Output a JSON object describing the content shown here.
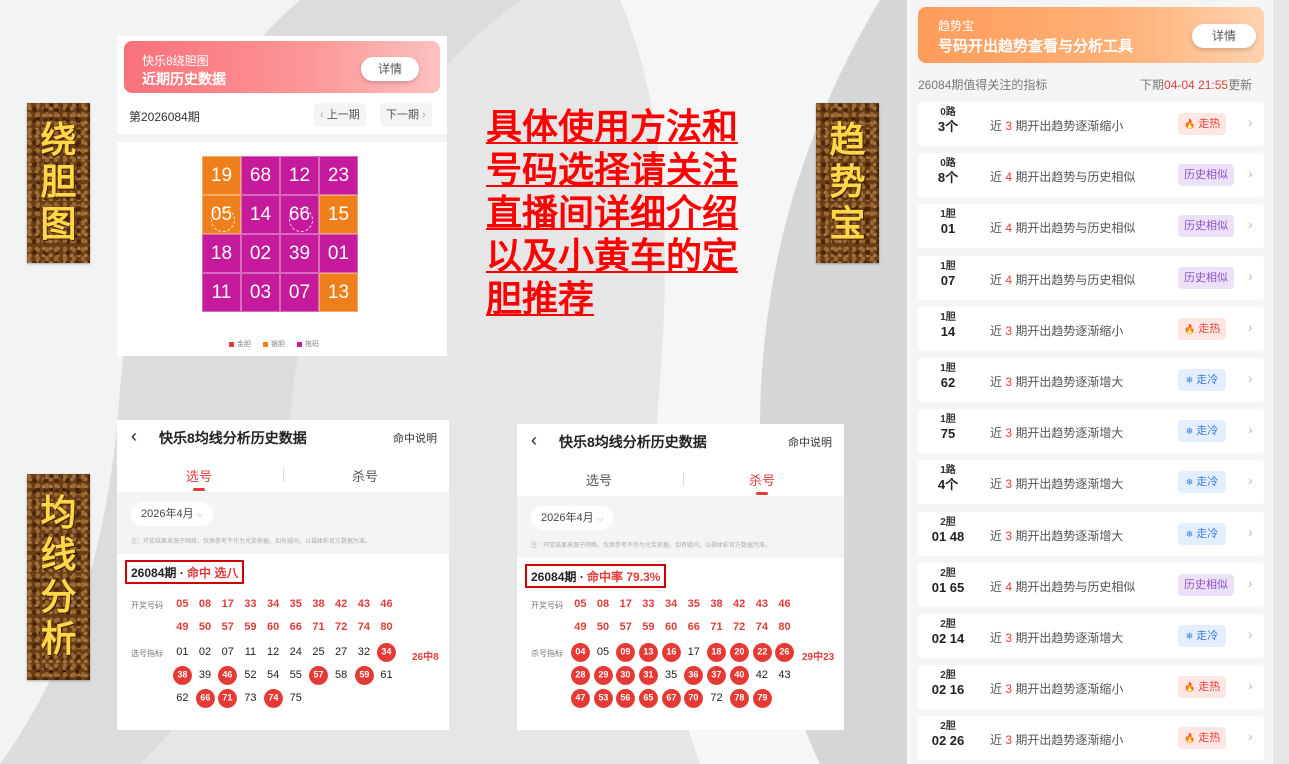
{
  "side_labels": {
    "left_top": [
      "绕",
      "胆",
      "图"
    ],
    "left_bottom": [
      "均",
      "线",
      "分",
      "析"
    ],
    "middle_right": [
      "趋",
      "势",
      "宝"
    ]
  },
  "center_text": [
    "具体使用方法和",
    "号码选择请关注",
    "直播间详细介绍",
    "以及小黄车的定",
    "胆推荐"
  ],
  "rdt": {
    "subtitle": "快乐8绕胆图",
    "title": "近期历史数据",
    "detail_btn": "详情",
    "period": "第2026084期",
    "prev": "上一期",
    "next": "下一期",
    "grid": [
      {
        "num": "19",
        "color": "#ef7f1a"
      },
      {
        "num": "68",
        "color": "#c41a9b"
      },
      {
        "num": "12",
        "color": "#c41a9b"
      },
      {
        "num": "23",
        "color": "#c41a9b"
      },
      {
        "num": "05",
        "color": "#ef7f1a"
      },
      {
        "num": "14",
        "color": "#c41a9b"
      },
      {
        "num": "66",
        "color": "#c41a9b"
      },
      {
        "num": "15",
        "color": "#ef7f1a"
      },
      {
        "num": "18",
        "color": "#c41a9b"
      },
      {
        "num": "02",
        "color": "#c41a9b"
      },
      {
        "num": "39",
        "color": "#c41a9b"
      },
      {
        "num": "01",
        "color": "#c41a9b"
      },
      {
        "num": "11",
        "color": "#c41a9b"
      },
      {
        "num": "03",
        "color": "#c41a9b"
      },
      {
        "num": "07",
        "color": "#c41a9b"
      },
      {
        "num": "13",
        "color": "#ef7f1a"
      }
    ],
    "legend": [
      {
        "label": "金胆",
        "color": "#e53935"
      },
      {
        "label": "银胆",
        "color": "#ef7f1a"
      },
      {
        "label": "拖码",
        "color": "#c41a9b"
      }
    ]
  },
  "trend": {
    "app_name": "趋势宝",
    "title": "号码开出趋势查看与分析工具",
    "detail_btn": "详情",
    "subtitle": "26084期值得关注的指标",
    "next_prefix": "下期",
    "next_time": "04-04 21:55",
    "next_suffix": "更新",
    "rows": [
      {
        "cat": "0路",
        "num": "3个",
        "pre": "近",
        "n": "3",
        "post": "期开出趋势逐渐缩小",
        "tag": "走热",
        "type": "hot"
      },
      {
        "cat": "0路",
        "num": "8个",
        "pre": "近",
        "n": "4",
        "post": "期开出趋势与历史相似",
        "tag": "历史相似",
        "type": "similar"
      },
      {
        "cat": "1胆",
        "num": "01",
        "pre": "近",
        "n": "4",
        "post": "期开出趋势与历史相似",
        "tag": "历史相似",
        "type": "similar"
      },
      {
        "cat": "1胆",
        "num": "07",
        "pre": "近",
        "n": "4",
        "post": "期开出趋势与历史相似",
        "tag": "历史相似",
        "type": "similar"
      },
      {
        "cat": "1胆",
        "num": "14",
        "pre": "近",
        "n": "3",
        "post": "期开出趋势逐渐缩小",
        "tag": "走热",
        "type": "hot"
      },
      {
        "cat": "1胆",
        "num": "62",
        "pre": "近",
        "n": "3",
        "post": "期开出趋势逐渐增大",
        "tag": "走冷",
        "type": "cold"
      },
      {
        "cat": "1胆",
        "num": "75",
        "pre": "近",
        "n": "3",
        "post": "期开出趋势逐渐增大",
        "tag": "走冷",
        "type": "cold"
      },
      {
        "cat": "1路",
        "num": "4个",
        "pre": "近",
        "n": "3",
        "post": "期开出趋势逐渐增大",
        "tag": "走冷",
        "type": "cold"
      },
      {
        "cat": "2胆",
        "num": "01 48",
        "pre": "近",
        "n": "3",
        "post": "期开出趋势逐渐增大",
        "tag": "走冷",
        "type": "cold"
      },
      {
        "cat": "2胆",
        "num": "01 65",
        "pre": "近",
        "n": "4",
        "post": "期开出趋势与历史相似",
        "tag": "历史相似",
        "type": "similar"
      },
      {
        "cat": "2胆",
        "num": "02 14",
        "pre": "近",
        "n": "3",
        "post": "期开出趋势逐渐增大",
        "tag": "走冷",
        "type": "cold"
      },
      {
        "cat": "2胆",
        "num": "02 16",
        "pre": "近",
        "n": "3",
        "post": "期开出趋势逐渐缩小",
        "tag": "走热",
        "type": "hot"
      },
      {
        "cat": "2胆",
        "num": "02 26",
        "pre": "近",
        "n": "3",
        "post": "期开出趋势逐渐缩小",
        "tag": "走热",
        "type": "hot"
      }
    ]
  },
  "analysis": {
    "title": "快乐8均线分析历史数据",
    "help": "命中说明",
    "tab_pick": "选号",
    "tab_kill": "杀号",
    "month": "2026年4月",
    "note": "注：开奖结果来源于网络，仅供参考不作为兑奖依据。如有疑问，以福体彩官方数据为准。",
    "draw_label": "开奖号码",
    "draw": [
      "05",
      "08",
      "17",
      "33",
      "34",
      "35",
      "38",
      "42",
      "43",
      "46",
      "49",
      "50",
      "57",
      "59",
      "60",
      "66",
      "71",
      "72",
      "74",
      "80"
    ],
    "pick": {
      "issue": "26084期 · ",
      "result": "命中 选八",
      "label": "选号指标",
      "score": "26中8",
      "nums": [
        {
          "v": "01",
          "c": false
        },
        {
          "v": "02",
          "c": false
        },
        {
          "v": "07",
          "c": false
        },
        {
          "v": "11",
          "c": false
        },
        {
          "v": "12",
          "c": false
        },
        {
          "v": "24",
          "c": false
        },
        {
          "v": "25",
          "c": false
        },
        {
          "v": "27",
          "c": false
        },
        {
          "v": "32",
          "c": false
        },
        {
          "v": "34",
          "c": true
        },
        {
          "v": "38",
          "c": true
        },
        {
          "v": "39",
          "c": false
        },
        {
          "v": "46",
          "c": true
        },
        {
          "v": "52",
          "c": false
        },
        {
          "v": "54",
          "c": false
        },
        {
          "v": "55",
          "c": false
        },
        {
          "v": "57",
          "c": true
        },
        {
          "v": "58",
          "c": false
        },
        {
          "v": "59",
          "c": true
        },
        {
          "v": "61",
          "c": false
        },
        {
          "v": "62",
          "c": false
        },
        {
          "v": "66",
          "c": true
        },
        {
          "v": "71",
          "c": true
        },
        {
          "v": "73",
          "c": false
        },
        {
          "v": "74",
          "c": true
        },
        {
          "v": "75",
          "c": false
        }
      ]
    },
    "kill": {
      "issue": "26084期 · ",
      "result": "命中率 79.3%",
      "label": "杀号指标",
      "score": "29中23",
      "nums": [
        {
          "v": "04",
          "c": true
        },
        {
          "v": "05",
          "c": false
        },
        {
          "v": "09",
          "c": true
        },
        {
          "v": "13",
          "c": true
        },
        {
          "v": "16",
          "c": true
        },
        {
          "v": "17",
          "c": false
        },
        {
          "v": "18",
          "c": true
        },
        {
          "v": "20",
          "c": true
        },
        {
          "v": "22",
          "c": true
        },
        {
          "v": "26",
          "c": true
        },
        {
          "v": "28",
          "c": true
        },
        {
          "v": "29",
          "c": true
        },
        {
          "v": "30",
          "c": true
        },
        {
          "v": "31",
          "c": true
        },
        {
          "v": "35",
          "c": false
        },
        {
          "v": "36",
          "c": true
        },
        {
          "v": "37",
          "c": true
        },
        {
          "v": "40",
          "c": true
        },
        {
          "v": "42",
          "c": false
        },
        {
          "v": "43",
          "c": false
        },
        {
          "v": "47",
          "c": true
        },
        {
          "v": "53",
          "c": true
        },
        {
          "v": "56",
          "c": true
        },
        {
          "v": "65",
          "c": true
        },
        {
          "v": "67",
          "c": true
        },
        {
          "v": "70",
          "c": true
        },
        {
          "v": "72",
          "c": false
        },
        {
          "v": "78",
          "c": true
        },
        {
          "v": "79",
          "c": true
        }
      ]
    }
  }
}
